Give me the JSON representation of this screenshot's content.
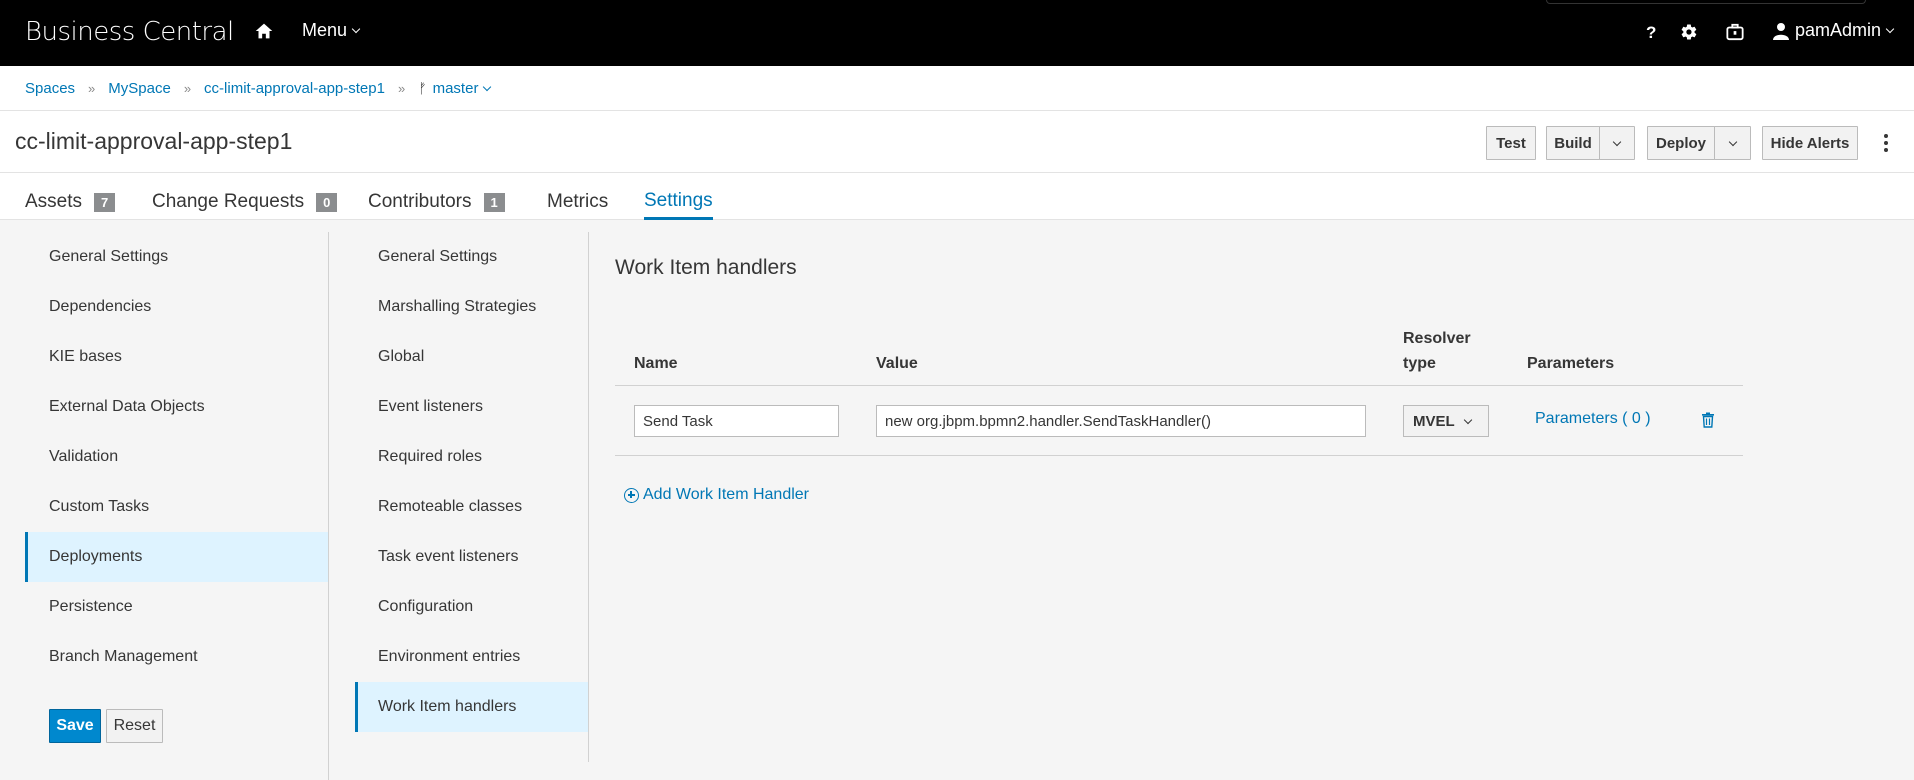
{
  "app": {
    "brand": "Business Central",
    "menu_label": "Menu",
    "user": "pamAdmin"
  },
  "topbar_icons": [
    "home-icon",
    "help-icon",
    "gear-icon",
    "briefcase-icon",
    "user-icon"
  ],
  "breadcrumbs": {
    "spaces": "Spaces",
    "space": "MySpace",
    "project": "cc-limit-approval-app-step1",
    "branch": "master"
  },
  "project": {
    "title": "cc-limit-approval-app-step1",
    "buttons": {
      "test": "Test",
      "build": "Build",
      "deploy": "Deploy",
      "hide_alerts": "Hide Alerts"
    }
  },
  "tabs": [
    {
      "label": "Assets",
      "badge": "7"
    },
    {
      "label": "Change Requests",
      "badge": "0"
    },
    {
      "label": "Contributors",
      "badge": "1"
    },
    {
      "label": "Metrics",
      "badge": ""
    },
    {
      "label": "Settings",
      "badge": "",
      "active": true
    }
  ],
  "left_nav": {
    "items": [
      "General Settings",
      "Dependencies",
      "KIE bases",
      "External Data Objects",
      "Validation",
      "Custom Tasks",
      "Deployments",
      "Persistence",
      "Branch Management"
    ],
    "active": "Deployments",
    "save_label": "Save",
    "reset_label": "Reset"
  },
  "mid_nav": {
    "items": [
      "General Settings",
      "Marshalling Strategies",
      "Global",
      "Event listeners",
      "Required roles",
      "Remoteable classes",
      "Task event listeners",
      "Configuration",
      "Environment entries",
      "Work Item handlers"
    ],
    "active": "Work Item handlers"
  },
  "content": {
    "title": "Work Item handlers",
    "columns": {
      "name": "Name",
      "value": "Value",
      "resolver_line1": "Resolver",
      "resolver_line2": "type",
      "parameters": "Parameters"
    },
    "rows": [
      {
        "name": "Send Task",
        "value": "new org.jbpm.bpmn2.handler.SendTaskHandler()",
        "resolver": "MVEL",
        "parameters_link": "Parameters ( 0 )"
      }
    ],
    "add_label": "Add Work Item Handler"
  },
  "colors": {
    "accent": "#0077b5",
    "primary_button": "#0088ce",
    "active_bg": "#def3ff",
    "topbar": "#000000"
  }
}
